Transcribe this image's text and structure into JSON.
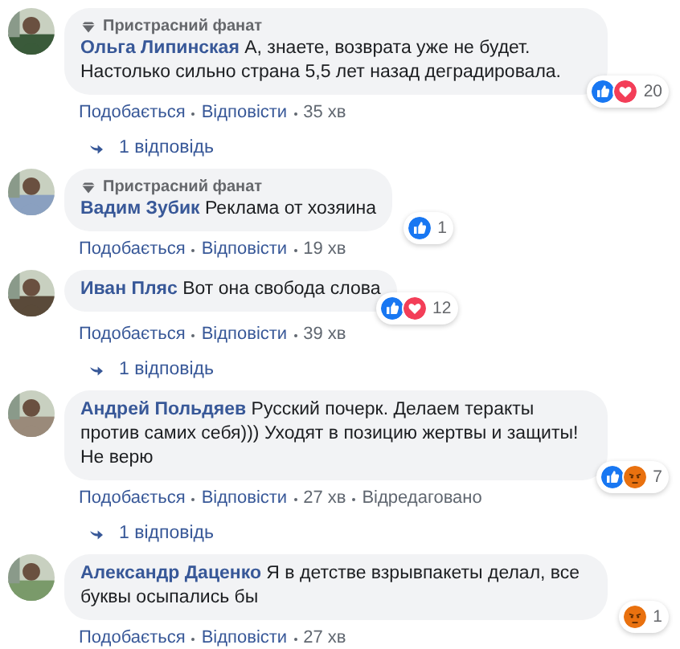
{
  "comments": [
    {
      "badge": "Пристрасний фанат",
      "author": "Ольга Липинская",
      "text": "А, знаете, возврата уже не будет. Настолько сильно страна 5,5 лет назад деградировала.",
      "reactions": [
        {
          "kind": "like"
        },
        {
          "kind": "love"
        }
      ],
      "reaction_count": "20",
      "actions": {
        "like": "Подобається",
        "reply": "Відповісти",
        "time": "35 хв"
      },
      "replies": "1 відповідь"
    },
    {
      "badge": "Пристрасний фанат",
      "author": "Вадим Зубик",
      "text": "Реклама от хозяина",
      "reactions": [
        {
          "kind": "like"
        }
      ],
      "reaction_count": "1",
      "actions": {
        "like": "Подобається",
        "reply": "Відповісти",
        "time": "19 хв"
      }
    },
    {
      "author": "Иван Пляс",
      "text": "Вот она свобода слова",
      "reactions": [
        {
          "kind": "like"
        },
        {
          "kind": "love"
        }
      ],
      "reaction_count": "12",
      "actions": {
        "like": "Подобається",
        "reply": "Відповісти",
        "time": "39 хв"
      },
      "replies": "1 відповідь"
    },
    {
      "author": "Андрей Польдяев",
      "text": "Русский почерк. Делаем теракты против самих себя))) Уходят в позицию жертвы и защиты! Не верю",
      "reactions": [
        {
          "kind": "like"
        },
        {
          "kind": "angry"
        }
      ],
      "reaction_count": "7",
      "actions": {
        "like": "Подобається",
        "reply": "Відповісти",
        "time": "27 хв",
        "edited": "Відредаговано"
      },
      "replies": "1 відповідь"
    },
    {
      "author": "Александр Даценко",
      "text": "Я в детстве взрывпакеты делал, все буквы осыпались бы",
      "reactions": [
        {
          "kind": "angry"
        }
      ],
      "reaction_count": "1",
      "actions": {
        "like": "Подобається",
        "reply": "Відповісти",
        "time": "27 хв"
      }
    }
  ]
}
